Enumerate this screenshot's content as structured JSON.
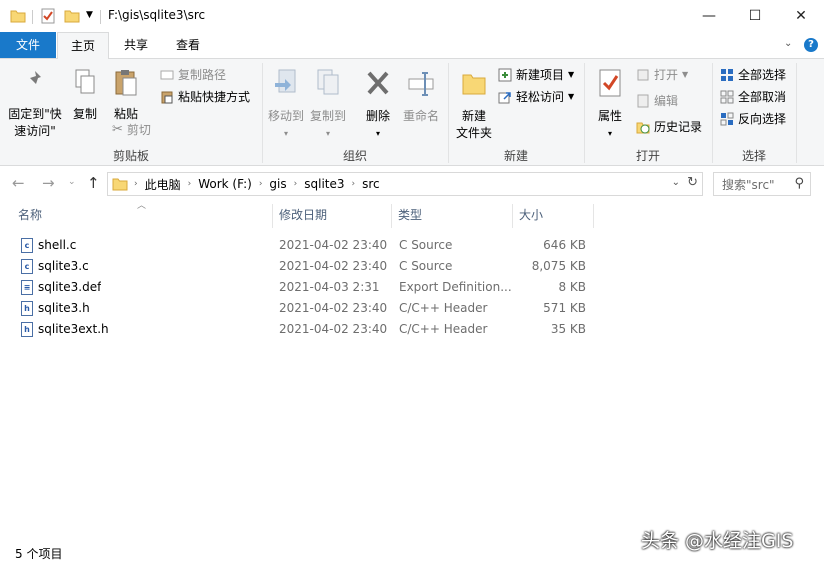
{
  "window": {
    "title": "F:\\gis\\sqlite3\\src",
    "minimize": "—",
    "maximize": "☐",
    "close": "✕"
  },
  "tabs": {
    "file": "文件",
    "home": "主页",
    "share": "共享",
    "view": "查看"
  },
  "ribbon": {
    "clipboard": {
      "label": "剪贴板",
      "pin": "固定到\"快",
      "pin2": "速访问\"",
      "copy": "复制",
      "paste": "粘贴",
      "copy_path": "复制路径",
      "paste_shortcut": "粘贴快捷方式",
      "cut": "剪切"
    },
    "organize": {
      "label": "组织",
      "move_to": "移动到",
      "copy_to": "复制到",
      "delete": "删除",
      "rename": "重命名"
    },
    "new": {
      "label": "新建",
      "new_item": "新建项目",
      "easy_access": "轻松访问",
      "new_folder": "新建",
      "new_folder2": "文件夹"
    },
    "open": {
      "label": "打开",
      "properties": "属性",
      "open": "打开",
      "edit": "编辑",
      "history": "历史记录"
    },
    "select": {
      "label": "选择",
      "select_all": "全部选择",
      "select_none": "全部取消",
      "invert": "反向选择"
    }
  },
  "address": {
    "crumbs": [
      "此电脑",
      "Work (F:)",
      "gis",
      "sqlite3",
      "src"
    ],
    "search_placeholder": "搜索\"src\""
  },
  "columns": {
    "name": "名称",
    "date": "修改日期",
    "type": "类型",
    "size": "大小"
  },
  "files": [
    {
      "name": "shell.c",
      "date": "2021-04-02 23:40",
      "type": "C Source",
      "size": "646 KB",
      "icon": "c"
    },
    {
      "name": "sqlite3.c",
      "date": "2021-04-02 23:40",
      "type": "C Source",
      "size": "8,075 KB",
      "icon": "c"
    },
    {
      "name": "sqlite3.def",
      "date": "2021-04-03 2:31",
      "type": "Export Definition...",
      "size": "8 KB",
      "icon": "≡"
    },
    {
      "name": "sqlite3.h",
      "date": "2021-04-02 23:40",
      "type": "C/C++ Header",
      "size": "571 KB",
      "icon": "h"
    },
    {
      "name": "sqlite3ext.h",
      "date": "2021-04-02 23:40",
      "type": "C/C++ Header",
      "size": "35 KB",
      "icon": "h"
    }
  ],
  "status": "5 个项目",
  "watermark": "头条 @水经注GIS",
  "colors": {
    "accent": "#1979ca",
    "ribbon_bg": "#f5f6f7"
  }
}
